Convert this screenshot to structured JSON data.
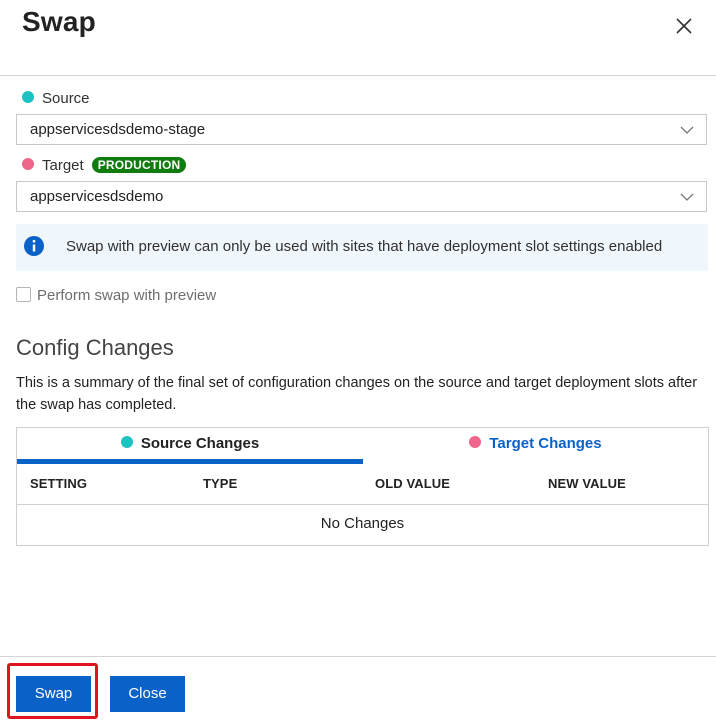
{
  "dialog": {
    "title": "Swap",
    "close_icon": "close-icon"
  },
  "colors": {
    "source_dot": "#1fc2c2",
    "target_dot": "#f0668a",
    "accent": "#0a62c9",
    "production_badge": "#107c10",
    "highlight": "#e0141e"
  },
  "source": {
    "label": "Source",
    "selected": "appservicesdsdemo-stage"
  },
  "target": {
    "label": "Target",
    "badge": "PRODUCTION",
    "selected": "appservicesdsdemo"
  },
  "info": {
    "icon": "info-icon",
    "message": "Swap with preview can only be used with sites that have deployment slot settings enabled"
  },
  "preview_checkbox": {
    "label": "Perform swap with preview",
    "checked": false
  },
  "config_changes": {
    "heading": "Config Changes",
    "description": "This is a summary of the final set of configuration changes on the source and target deployment slots after the swap has completed.",
    "tabs": [
      {
        "label": "Source Changes",
        "active": true
      },
      {
        "label": "Target Changes",
        "active": false
      }
    ],
    "columns": [
      "SETTING",
      "TYPE",
      "OLD VALUE",
      "NEW VALUE"
    ],
    "empty_message": "No Changes"
  },
  "footer": {
    "swap_label": "Swap",
    "close_label": "Close"
  }
}
